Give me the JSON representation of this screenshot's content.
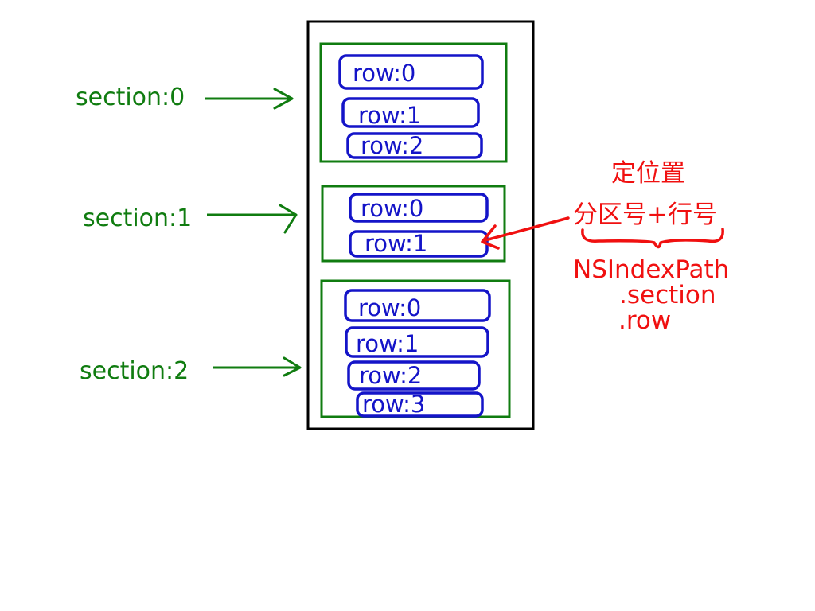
{
  "sections": [
    {
      "label": "section:0",
      "rows": [
        "row:0",
        "row:1",
        "row:2"
      ]
    },
    {
      "label": "section:1",
      "rows": [
        "row:0",
        "row:1"
      ]
    },
    {
      "label": "section:2",
      "rows": [
        "row:0",
        "row:1",
        "row:2",
        "row:3"
      ]
    }
  ],
  "annotation": {
    "title": "定位置",
    "subtitle": "分区号+行号",
    "code_lines": [
      "NSIndexPath",
      ".section",
      ".row"
    ]
  },
  "colors": {
    "section": "#107c10",
    "row": "#1414c8",
    "annotation": "#f01010",
    "table_border": "#000000"
  }
}
